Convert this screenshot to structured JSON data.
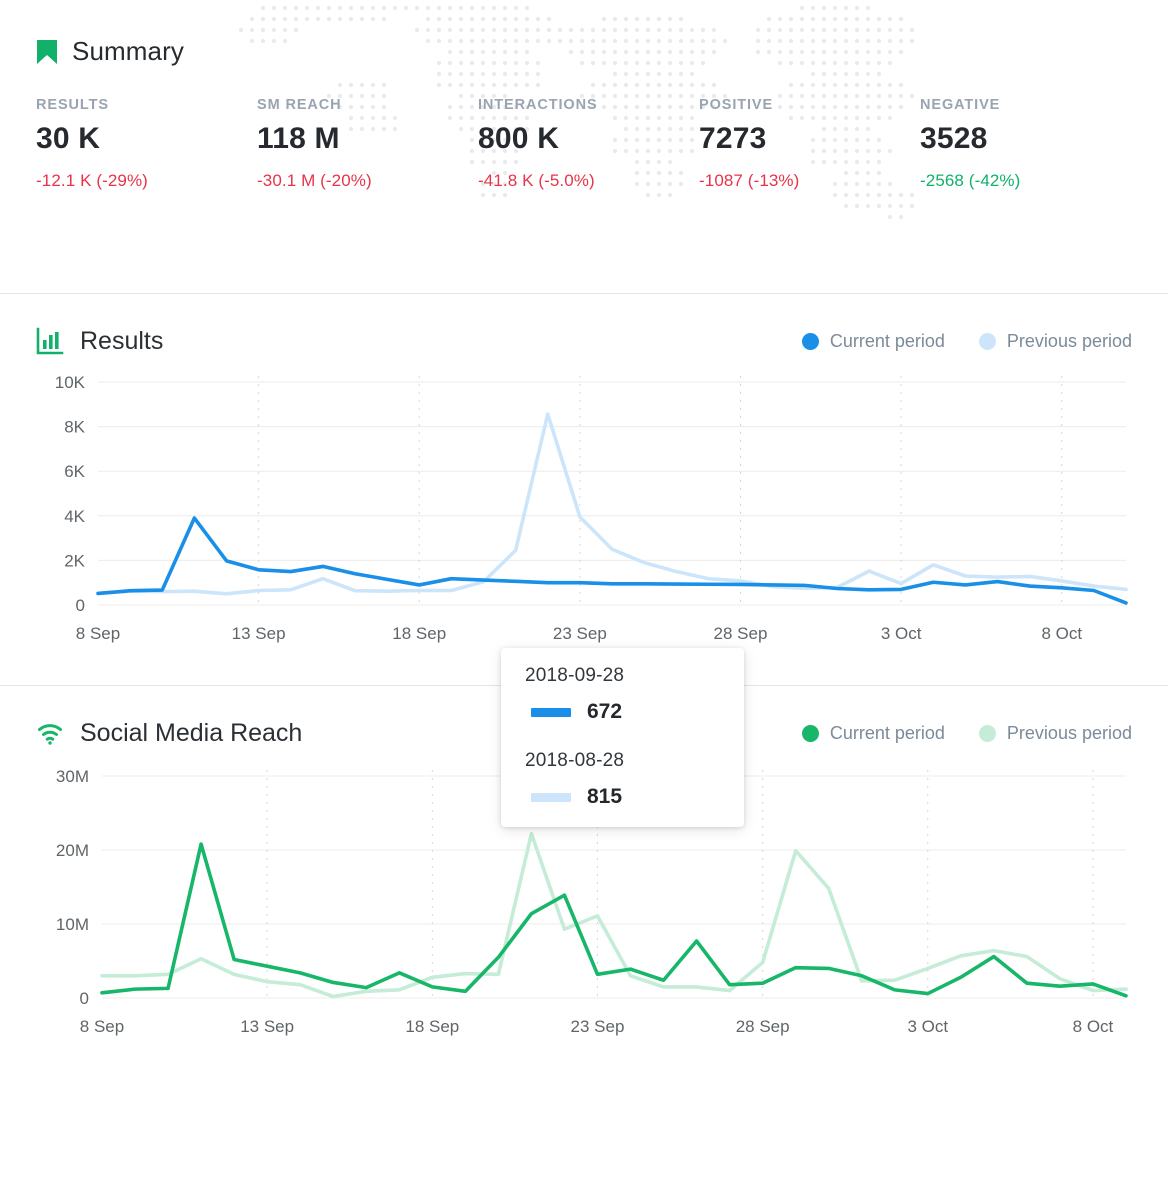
{
  "summary": {
    "icon": "bookmark-icon",
    "title": "Summary",
    "accent_color": "#11b16a",
    "negative_color": "#e8334a",
    "positive_color": "#11b16a",
    "metrics": [
      {
        "label": "RESULTS",
        "value": "30 K",
        "delta": "-12.1 K  (-29%)",
        "delta_sign": "negative"
      },
      {
        "label": "SM REACH",
        "value": "118 M",
        "delta": "-30.1 M  (-20%)",
        "delta_sign": "negative"
      },
      {
        "label": "INTERACTIONS",
        "value": "800 K",
        "delta": "-41.8 K  (-5.0%)",
        "delta_sign": "negative"
      },
      {
        "label": "POSITIVE",
        "value": "7273",
        "delta": "-1087  (-13%)",
        "delta_sign": "negative"
      },
      {
        "label": "NEGATIVE",
        "value": "3528",
        "delta": "-2568  (-42%)",
        "delta_sign": "positive"
      }
    ]
  },
  "results_panel": {
    "icon": "bar-chart-icon",
    "title": "Results",
    "legend": [
      {
        "label": "Current period",
        "color": "#1a8fe8"
      },
      {
        "label": "Previous period",
        "color": "#cce5fa"
      }
    ]
  },
  "reach_panel": {
    "icon": "wifi-icon",
    "title": "Social Media Reach",
    "legend": [
      {
        "label": "Current period",
        "color": "#18b668"
      },
      {
        "label": "Previous period",
        "color": "#c4ecd6"
      }
    ]
  },
  "tooltip": {
    "groups": [
      {
        "date": "2018-09-28",
        "value": "672",
        "color": "#1a8fe8"
      },
      {
        "date": "2018-08-28",
        "value": "815",
        "color": "#cce5fa"
      }
    ]
  },
  "chart_data": [
    {
      "id": "results",
      "type": "line",
      "title": "Results",
      "xlabel": "",
      "ylabel": "",
      "ylim": [
        0,
        10000
      ],
      "yticks": [
        0,
        2000,
        4000,
        6000,
        8000,
        10000
      ],
      "ytick_labels": [
        "0",
        "2K",
        "4K",
        "6K",
        "8K",
        "10K"
      ],
      "xticks": [
        0,
        5,
        10,
        15,
        20,
        25,
        30
      ],
      "xtick_labels": [
        "8 Sep",
        "13 Sep",
        "18 Sep",
        "23 Sep",
        "28 Sep",
        "3 Oct",
        "8 Oct"
      ],
      "grid": true,
      "legend_position": "top-right",
      "series": [
        {
          "name": "Current period",
          "color": "#1a8fe8",
          "values": [
            520,
            640,
            670,
            3900,
            1980,
            1580,
            1500,
            1730,
            1400,
            1150,
            900,
            1180,
            1120,
            1060,
            1000,
            1000,
            950,
            950,
            940,
            930,
            920,
            900,
            880,
            740,
            680,
            700,
            1020,
            900,
            1050,
            850,
            770,
            650,
            90
          ]
        },
        {
          "name": "Previous period",
          "color": "#cce5fa",
          "values": [
            520,
            620,
            600,
            620,
            500,
            650,
            680,
            1180,
            640,
            620,
            650,
            650,
            1040,
            2450,
            8560,
            3950,
            2500,
            1900,
            1500,
            1180,
            1080,
            830,
            750,
            780,
            1520,
            960,
            1800,
            1300,
            1250,
            1280,
            1080,
            850,
            700
          ]
        }
      ]
    },
    {
      "id": "social_media_reach",
      "type": "line",
      "title": "Social Media Reach",
      "xlabel": "",
      "ylabel": "",
      "ylim": [
        0,
        30000000
      ],
      "yticks": [
        0,
        10000000,
        20000000,
        30000000
      ],
      "ytick_labels": [
        "0",
        "10M",
        "20M",
        "30M"
      ],
      "xticks": [
        0,
        5,
        10,
        15,
        20,
        25,
        30
      ],
      "xtick_labels": [
        "8 Sep",
        "13 Sep",
        "18 Sep",
        "23 Sep",
        "28 Sep",
        "3 Oct",
        "8 Oct"
      ],
      "grid": true,
      "legend_position": "top-right",
      "series": [
        {
          "name": "Current period",
          "color": "#18b668",
          "values": [
            700000,
            1200000,
            1300000,
            20800000,
            5200000,
            4300000,
            3400000,
            2100000,
            1400000,
            3400000,
            1500000,
            900000,
            5500000,
            11400000,
            13900000,
            3200000,
            3900000,
            2400000,
            7700000,
            1800000,
            2000000,
            4100000,
            4000000,
            3000000,
            1100000,
            600000,
            2800000,
            5600000,
            2000000,
            1600000,
            1900000,
            300000
          ]
        },
        {
          "name": "Previous period",
          "color": "#c4ecd6",
          "values": [
            3000000,
            3000000,
            3200000,
            5300000,
            3200000,
            2200000,
            1800000,
            200000,
            900000,
            1100000,
            2800000,
            3300000,
            3200000,
            22200000,
            9300000,
            11100000,
            3000000,
            1500000,
            1500000,
            1000000,
            4800000,
            19900000,
            14800000,
            2300000,
            2400000,
            4000000,
            5700000,
            6400000,
            5600000,
            2600000,
            1000000,
            1200000
          ]
        }
      ]
    }
  ]
}
